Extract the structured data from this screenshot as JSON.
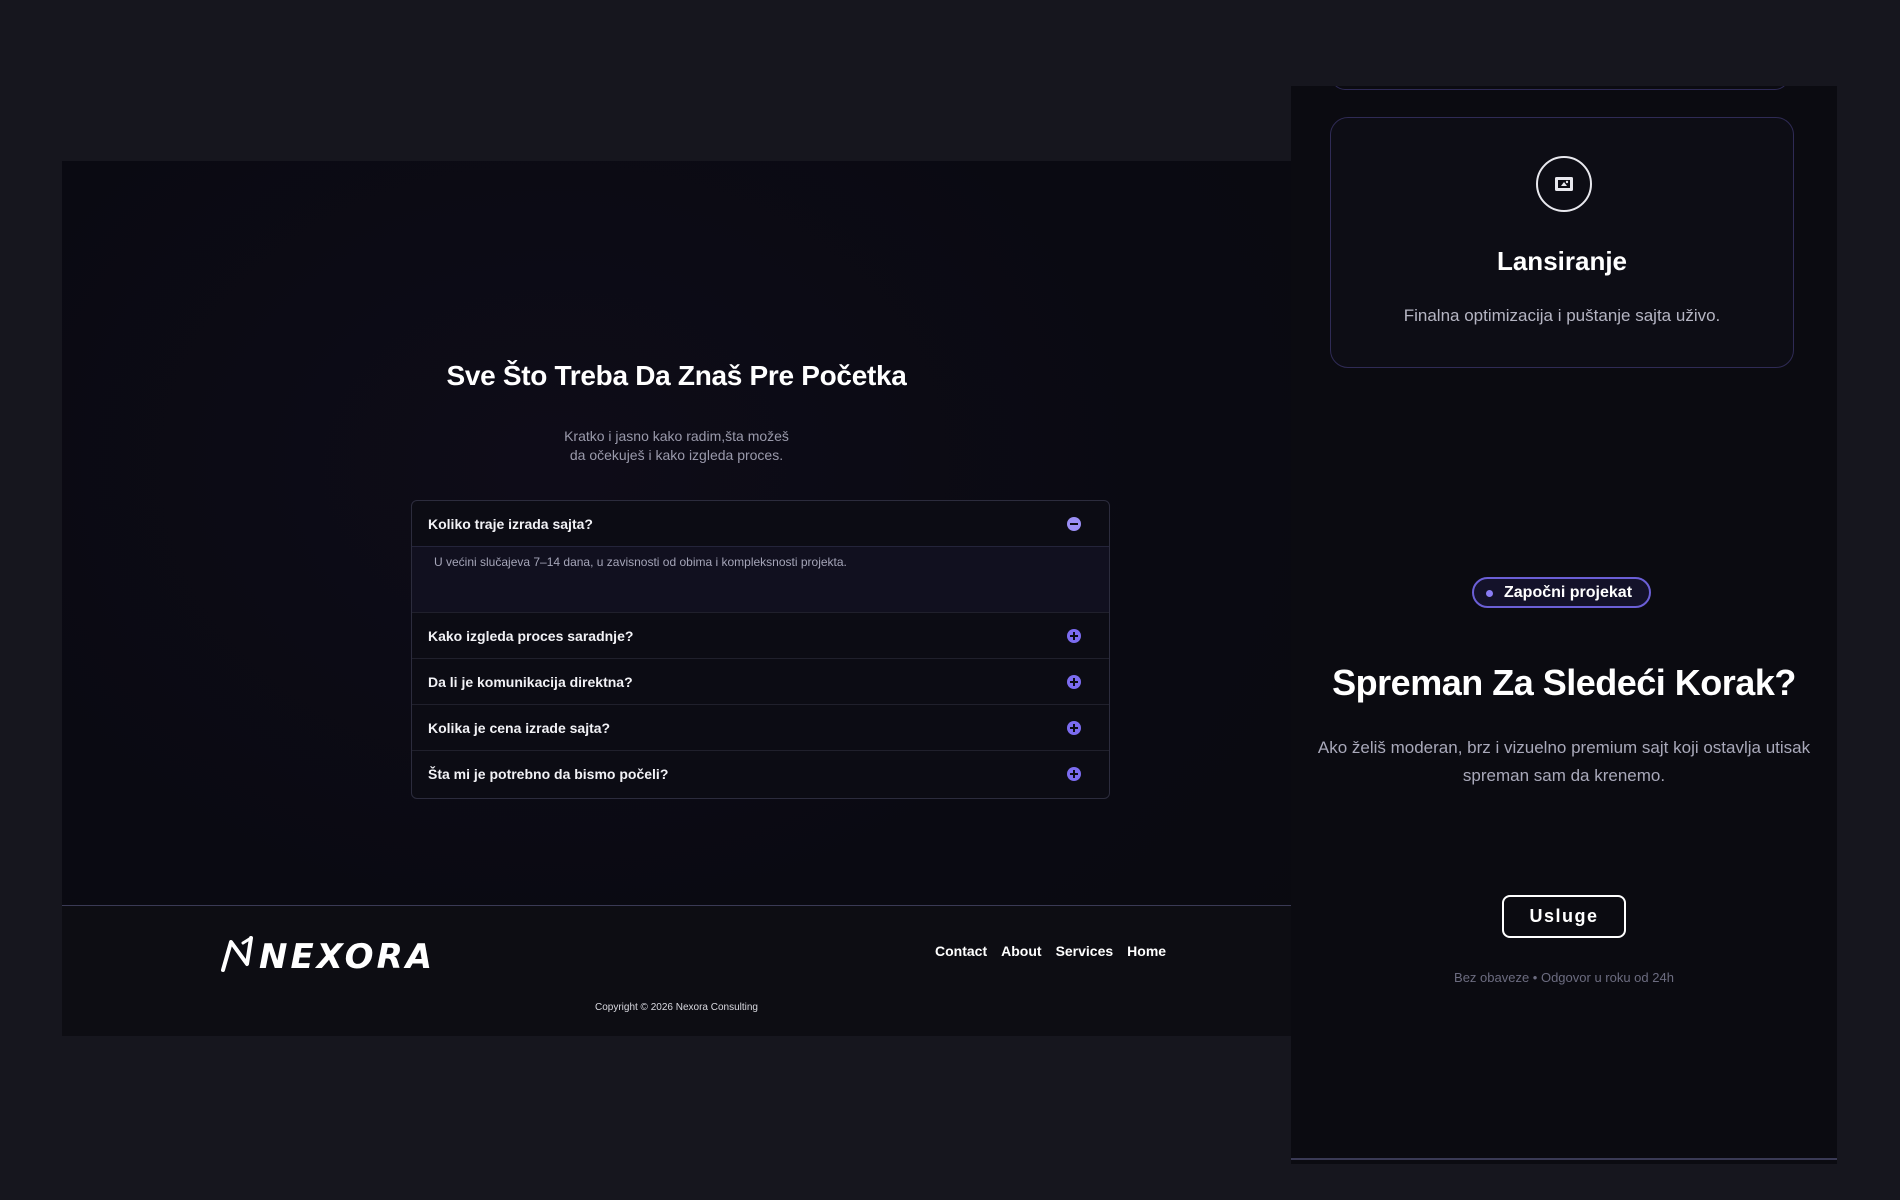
{
  "faq": {
    "title": "Sve Što Treba Da Znaš Pre Početka",
    "subtitle_line1": "Kratko i jasno kako radim,šta možeš",
    "subtitle_line2": "da očekuješ i kako izgleda proces.",
    "items": [
      {
        "question": "Koliko traje izrada sajta?",
        "answer": "U većini slučajeva 7–14 dana, u zavisnosti od obima i kompleksnosti projekta.",
        "expanded": true,
        "icon": "minus-circle-icon"
      },
      {
        "question": "Kako izgleda proces saradnje?",
        "expanded": false,
        "icon": "plus-circle-icon"
      },
      {
        "question": "Da li je komunikacija direktna?",
        "expanded": false,
        "icon": "plus-circle-icon"
      },
      {
        "question": "Kolika je cena izrade sajta?",
        "expanded": false,
        "icon": "plus-circle-icon"
      },
      {
        "question": "Šta mi je potrebno da bismo počeli?",
        "expanded": false,
        "icon": "plus-circle-icon"
      }
    ]
  },
  "footer": {
    "logo_text": "NEXORA",
    "nav": [
      "Contact",
      "About",
      "Services",
      "Home"
    ],
    "copyright": "Copyright © 2026 Nexora Consulting"
  },
  "step_card": {
    "icon": "launch-icon",
    "title": "Lansiranje",
    "description": "Finalna optimizacija i puštanje sajta uživo."
  },
  "cta": {
    "badge": "Započni projekat",
    "title": "Spreman Za Sledeći Korak?",
    "text": "Ako želiš moderan, brz i vizuelno premium sajt koji ostavlja utisak spreman sam da krenemo.",
    "button": "Usluge",
    "note": "Bez obaveze • Odgovor u roku od 24h"
  },
  "colors": {
    "accent": "#7c6cf0",
    "background": "#16161e",
    "panel": "#0b0b11"
  }
}
